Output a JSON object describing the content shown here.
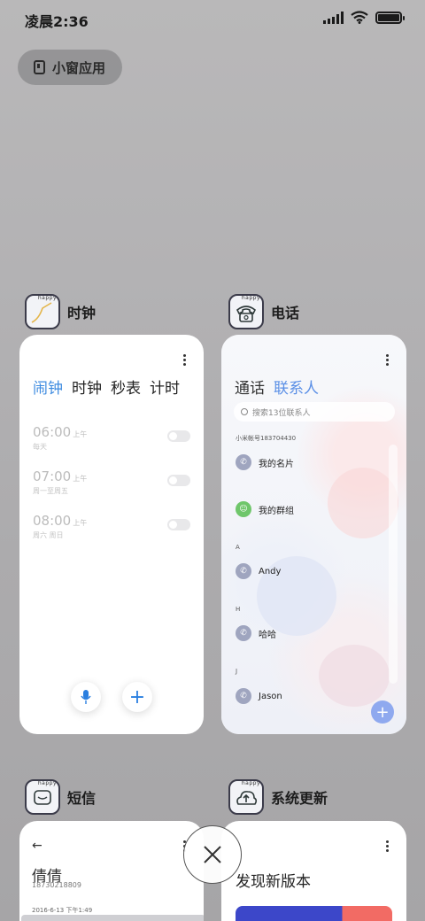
{
  "status_bar": {
    "time": "凌晨2:36"
  },
  "floating_window_button": {
    "label": "小窗应用"
  },
  "apps": {
    "clock": {
      "name": "时钟",
      "tabs": [
        "闹钟",
        "时钟",
        "秒表",
        "计时"
      ],
      "alarms": [
        {
          "time": "06:00",
          "ampm": "上午",
          "repeat": "每天"
        },
        {
          "time": "07:00",
          "ampm": "上午",
          "repeat": "周一至周五"
        },
        {
          "time": "08:00",
          "ampm": "上午",
          "repeat": "周六 周日"
        }
      ]
    },
    "phone": {
      "name": "电话",
      "tabs": [
        "通话",
        "联系人"
      ],
      "search_placeholder": "搜索13位联系人",
      "account": "小米帐号183704430",
      "my_card": "我的名片",
      "my_groups": "我的群组",
      "sections": [
        "A",
        "H",
        "J"
      ],
      "contacts": [
        "Andy",
        "哈哈",
        "Jason"
      ]
    },
    "sms": {
      "name": "短信",
      "contact_name": "倩倩",
      "contact_number": "18730218809",
      "date": "2016-6-13 下午1:49"
    },
    "update": {
      "name": "系统更新",
      "title": "发现新版本"
    }
  },
  "icon_badge": "happy"
}
